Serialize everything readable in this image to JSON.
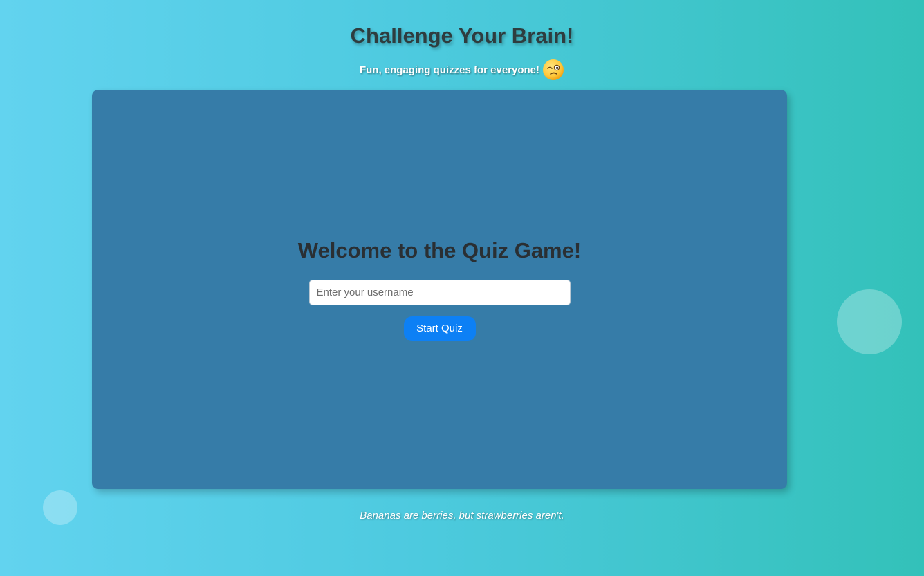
{
  "header": {
    "title": "Challenge Your Brain!",
    "tagline": "Fun, engaging quizzes for everyone!",
    "tagline_icon": "winking-face-icon"
  },
  "quiz_card": {
    "heading": "Welcome to the Quiz Game!",
    "username_input": {
      "value": "",
      "placeholder": "Enter your username"
    },
    "start_button_label": "Start Quiz"
  },
  "footer": {
    "fun_fact": "Bananas are berries, but strawberries aren't."
  },
  "colors": {
    "background_start": "#62d3ef",
    "background_end": "#33c1b9",
    "card": "#367ca8",
    "button": "#0d80f5",
    "heading_text": "#2a2f33"
  }
}
